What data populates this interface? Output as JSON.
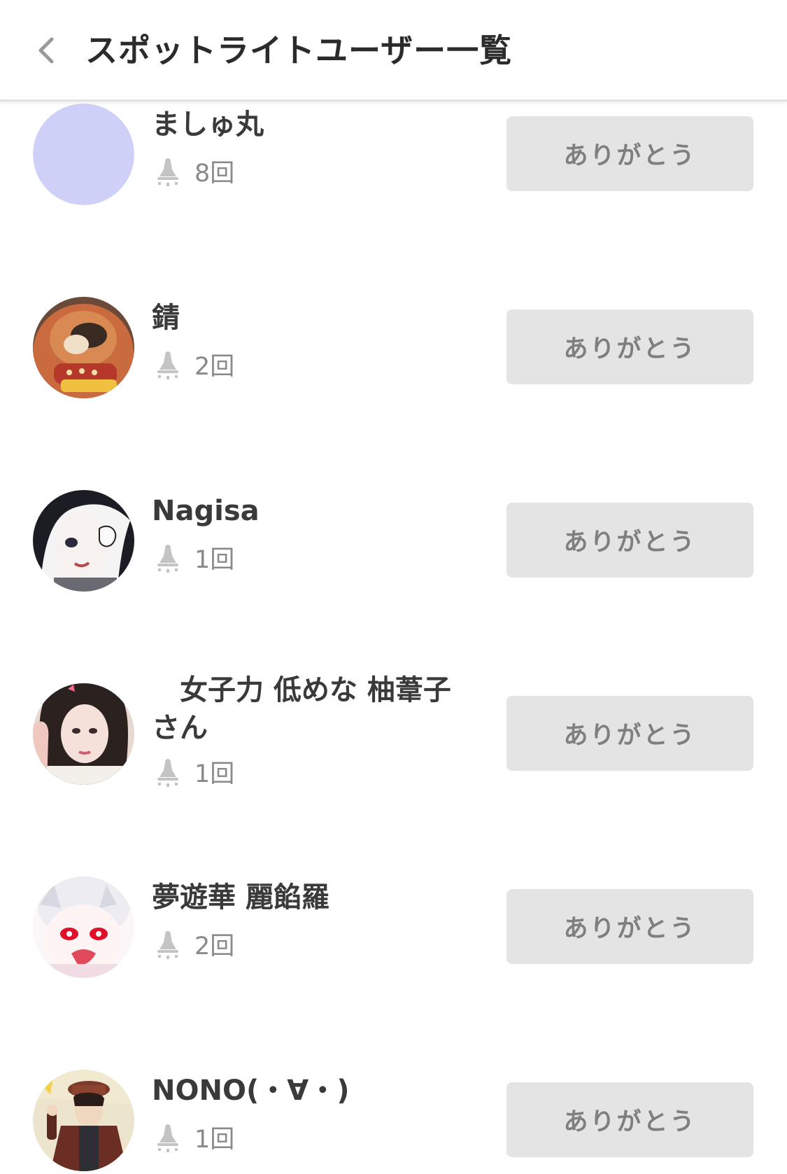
{
  "header": {
    "title": "スポットライトユーザー一覧"
  },
  "users": [
    {
      "name": "ましゅ丸",
      "count": "8回",
      "button_label": "ありがとう"
    },
    {
      "name": "錆",
      "count": "2回",
      "button_label": "ありがとう"
    },
    {
      "name": "Nagisa",
      "count": "1回",
      "button_label": "ありがとう"
    },
    {
      "name": "　女子力 低めな 柚葦子さん",
      "count": "1回",
      "button_label": "ありがとう"
    },
    {
      "name": "夢遊華 麗餡羅",
      "count": "2回",
      "button_label": "ありがとう"
    },
    {
      "name": "NONO(・∀・)",
      "count": "1回",
      "button_label": "ありがとう"
    }
  ],
  "icons": {
    "back": "chevron-left-icon",
    "spotlight": "spotlight-icon"
  },
  "colors": {
    "button_bg": "#e4e4e4",
    "button_text": "#7f7f7f",
    "avatar_placeholder": "#cfd0f7"
  }
}
